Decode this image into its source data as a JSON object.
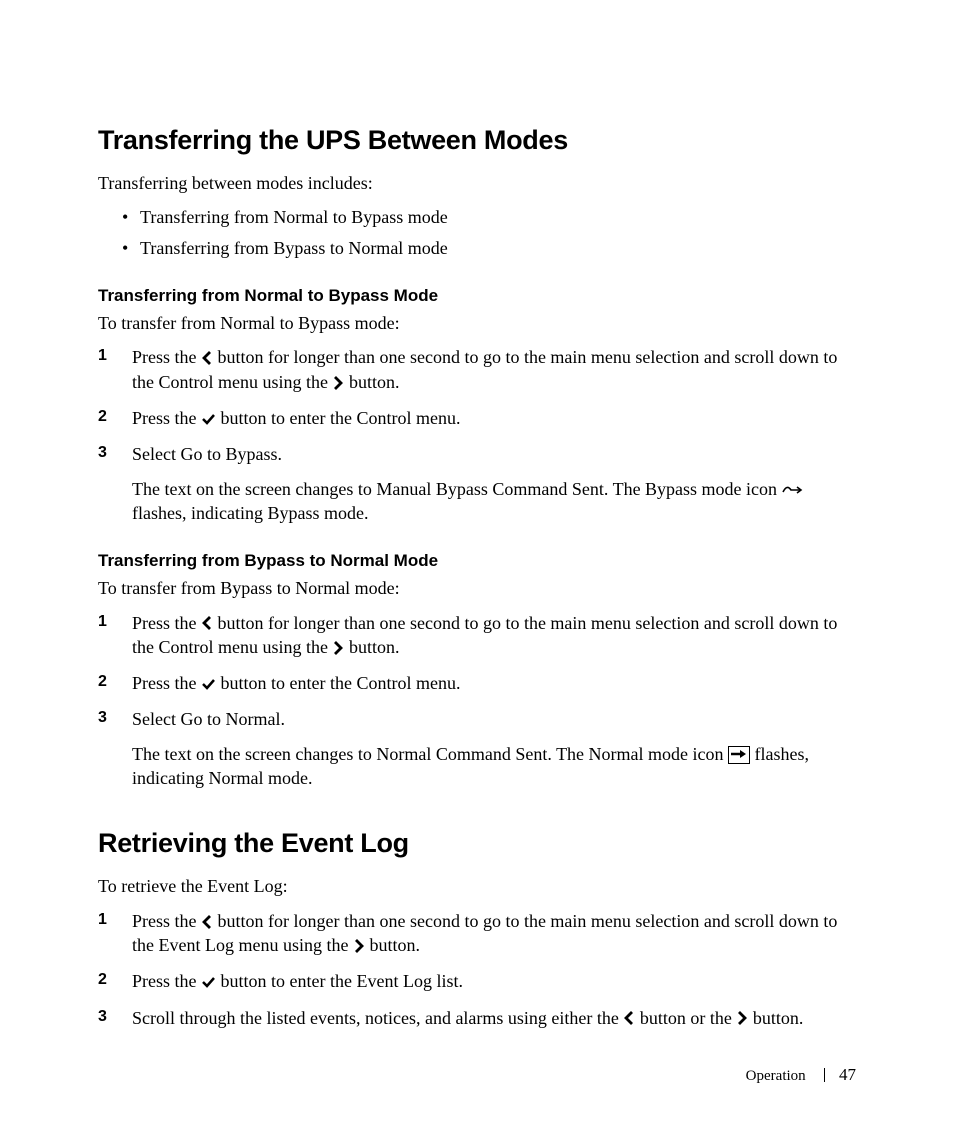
{
  "section1": {
    "heading": "Transferring the UPS Between Modes",
    "intro": "Transferring between modes includes:",
    "bullets": [
      "Transferring from Normal to Bypass mode",
      "Transferring from Bypass to Normal mode"
    ],
    "subA": {
      "heading": "Transferring from Normal to Bypass Mode",
      "intro": "To transfer from Normal to Bypass mode:",
      "steps": {
        "s1a": "Press the ",
        "s1b": " button for longer than one second to go to the main menu selection and scroll down to the Control menu using the ",
        "s1c": " button.",
        "s2a": "Press the ",
        "s2b": " button to enter the Control menu.",
        "s3": "Select Go to Bypass.",
        "s3sub_a": "The text on the screen changes to Manual Bypass Command Sent. The Bypass mode icon ",
        "s3sub_b": " flashes, indicating Bypass mode."
      }
    },
    "subB": {
      "heading": "Transferring from Bypass to Normal Mode",
      "intro": "To transfer from Bypass to Normal mode:",
      "steps": {
        "s1a": "Press the ",
        "s1b": " button for longer than one second to go to the main menu selection and scroll down to the Control menu using the ",
        "s1c": " button.",
        "s2a": "Press the ",
        "s2b": " button to enter the Control menu.",
        "s3": "Select Go to Normal.",
        "s3sub_a": "The text on the screen changes to Normal Command Sent. The Normal mode icon ",
        "s3sub_b": " flashes, indicating Normal mode."
      }
    }
  },
  "section2": {
    "heading": "Retrieving the Event Log",
    "intro": "To retrieve the Event Log:",
    "steps": {
      "s1a": "Press the ",
      "s1b": " button for longer than one second to go to the main menu selection and scroll down to the Event Log menu using the ",
      "s1c": " button.",
      "s2a": "Press the ",
      "s2b": " button to enter the Event Log list.",
      "s3a": "Scroll through the listed events, notices, and alarms using either the ",
      "s3b": " button or the ",
      "s3c": " button."
    }
  },
  "footer": {
    "chapter": "Operation",
    "page": "47"
  }
}
